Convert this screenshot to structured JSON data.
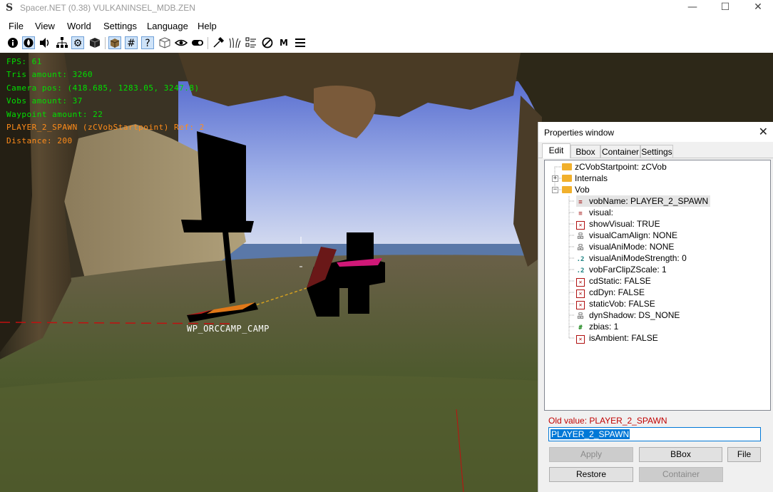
{
  "window": {
    "title": "Spacer.NET (0.38) VULKANINSEL_MDB.ZEN",
    "minimize": "—",
    "maximize": "☐",
    "close": "✕"
  },
  "menu": [
    "File",
    "View",
    "World",
    "Settings",
    "Language",
    "Help"
  ],
  "toolbar": {
    "icons": [
      "info-icon",
      "fire-icon",
      "speaker-icon",
      "hierarchy-icon",
      "gear-icon",
      "cube-dark-icon",
      "texture-icon",
      "grid-icon",
      "help-icon",
      "wireframe-cube-icon",
      "eye-icon",
      "toggle-icon",
      "picker-icon",
      "grass-icon",
      "list-icon",
      "no-entry-icon",
      "m-letter-icon",
      "menu-icon"
    ],
    "m_label": "M"
  },
  "hud": {
    "fps": "FPS: 61",
    "tris": "Tris amount: 3260",
    "camera": "Camera pos: (418.685, 1283.05, 3247.8)",
    "vobs": "Vobs amount: 37",
    "waypoints": "Waypoint amount: 22",
    "selected": "PLAYER_2_SPAWN (zCVobStartpoint) Ref: 2",
    "distance": "Distance: 200"
  },
  "scene": {
    "waypoint_label": "WP_ORCCAMP_CAMP"
  },
  "properties": {
    "title": "Properties window",
    "tabs": [
      "Edit",
      "Bbox",
      "Container",
      "Settings"
    ],
    "tree": {
      "root": "zCVobStartpoint: zCVob",
      "internals": "Internals",
      "vob": "Vob",
      "items": [
        {
          "icon": "string",
          "text": "vobName: PLAYER_2_SPAWN"
        },
        {
          "icon": "string",
          "text": "visual:"
        },
        {
          "icon": "bool",
          "text": "showVisual: TRUE"
        },
        {
          "icon": "enum",
          "text": "visualCamAlign: NONE"
        },
        {
          "icon": "enum",
          "text": "visualAniMode: NONE"
        },
        {
          "icon": "float",
          "text": "visualAniModeStrength: 0"
        },
        {
          "icon": "float",
          "text": "vobFarClipZScale: 1"
        },
        {
          "icon": "bool",
          "text": "cdStatic: FALSE"
        },
        {
          "icon": "bool",
          "text": "cdDyn: FALSE"
        },
        {
          "icon": "bool",
          "text": "staticVob: FALSE"
        },
        {
          "icon": "enum",
          "text": "dynShadow: DS_NONE"
        },
        {
          "icon": "int",
          "text": "zbias: 1"
        },
        {
          "icon": "bool",
          "text": "isAmbient: FALSE"
        }
      ]
    },
    "old_value": "Old value: PLAYER_2_SPAWN",
    "edit_value": "PLAYER_2_SPAWN",
    "buttons": {
      "apply": "Apply",
      "bbox": "BBox",
      "file": "File",
      "restore": "Restore",
      "container": "Container"
    }
  }
}
